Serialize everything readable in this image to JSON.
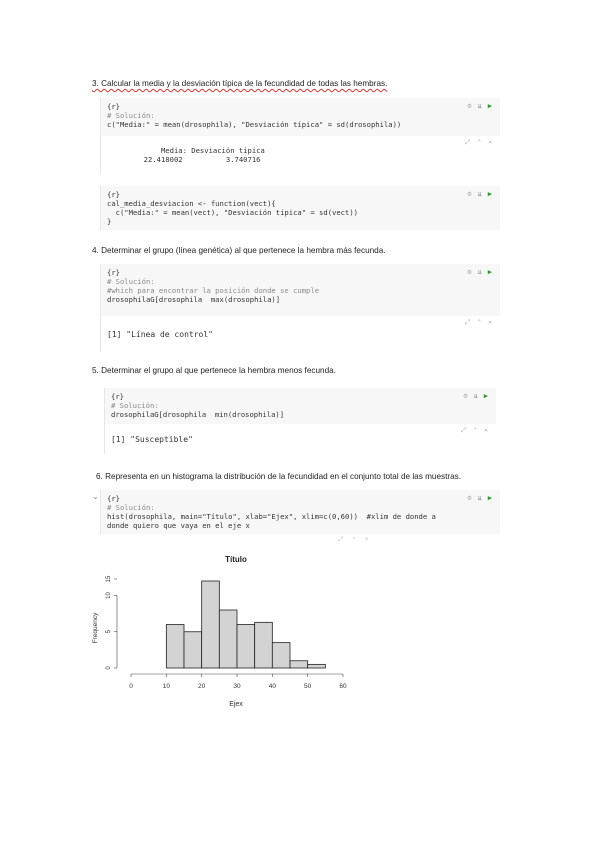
{
  "questions": {
    "q3": "3. Calcular la media y la desviación típica de la fecundidad de todas las hembras.",
    "q4": "4. Determinar el grupo (línea genética) al que pertenece la hembra más fecunda.",
    "q5": "5. Determinar el grupo al que pertenece la hembra menos fecunda.",
    "q6": "6. Representa en un histograma la distribución de la fecundidad en el conjunto total de las muestras."
  },
  "chunk1": {
    "header": "{r}",
    "comment": "# Solución:",
    "line": "c(\"Media:\" = mean(drosophila), \"Desviación típica\" = sd(drosophila))"
  },
  "output1": {
    "header": "      Media: Desviación típica",
    "values": "  22.418002          3.740716"
  },
  "chunk2": {
    "header": "{r}",
    "line1": "cal_media_desviacion <- function(vect){",
    "line2": "  c(\"Media:\" = mean(vect), \"Desviación típica\" = sd(vect))",
    "line3": "}"
  },
  "chunk3": {
    "header": "{r}",
    "comment1": "# Solución:",
    "comment2": "#which para encontrar la posición donde se cumple",
    "line": "drosophilaG[drosophila  max(drosophila)]"
  },
  "output3": {
    "line": "[1] \"Línea de control\""
  },
  "chunk4": {
    "header": "{r}",
    "comment": "# Solución:",
    "line": "drosophilaG[drosophila  min(drosophila)]"
  },
  "output4": {
    "line": "[1] \"Susceptible\""
  },
  "chunk5": {
    "header": "{r}",
    "comment": "# Solución:",
    "line1": "hist(drosophila, main=\"Título\", xlab=\"Ejex\", xlim=c(0,60))  #xlim de donde a",
    "line2": "donde quiero que vaya en el eje x"
  },
  "controls": {
    "gear": "⚙",
    "download": "⇊",
    "run": "▶",
    "expand": "⤢",
    "collapse": "⌃",
    "close": "×",
    "fold": "⌄"
  },
  "chart_data": {
    "type": "bar",
    "title": "Título",
    "xlabel": "Ejex",
    "ylabel": "Frequency",
    "xlim": [
      0,
      60
    ],
    "ylim": [
      0,
      12
    ],
    "x_ticks": [
      "0",
      "10",
      "20",
      "30",
      "40",
      "50",
      "60"
    ],
    "y_ticks": [
      "0",
      "5",
      "10",
      "15"
    ],
    "bins": [
      [
        10,
        15
      ],
      [
        15,
        20
      ],
      [
        20,
        25
      ],
      [
        25,
        30
      ],
      [
        30,
        35
      ],
      [
        35,
        40
      ],
      [
        40,
        45
      ],
      [
        45,
        50
      ],
      [
        50,
        55
      ]
    ],
    "values": [
      6,
      5,
      12,
      8,
      6,
      6.3,
      3.5,
      1,
      0.5
    ],
    "colors": {
      "bar": "#d3d3d3",
      "edge": "#222222"
    }
  }
}
